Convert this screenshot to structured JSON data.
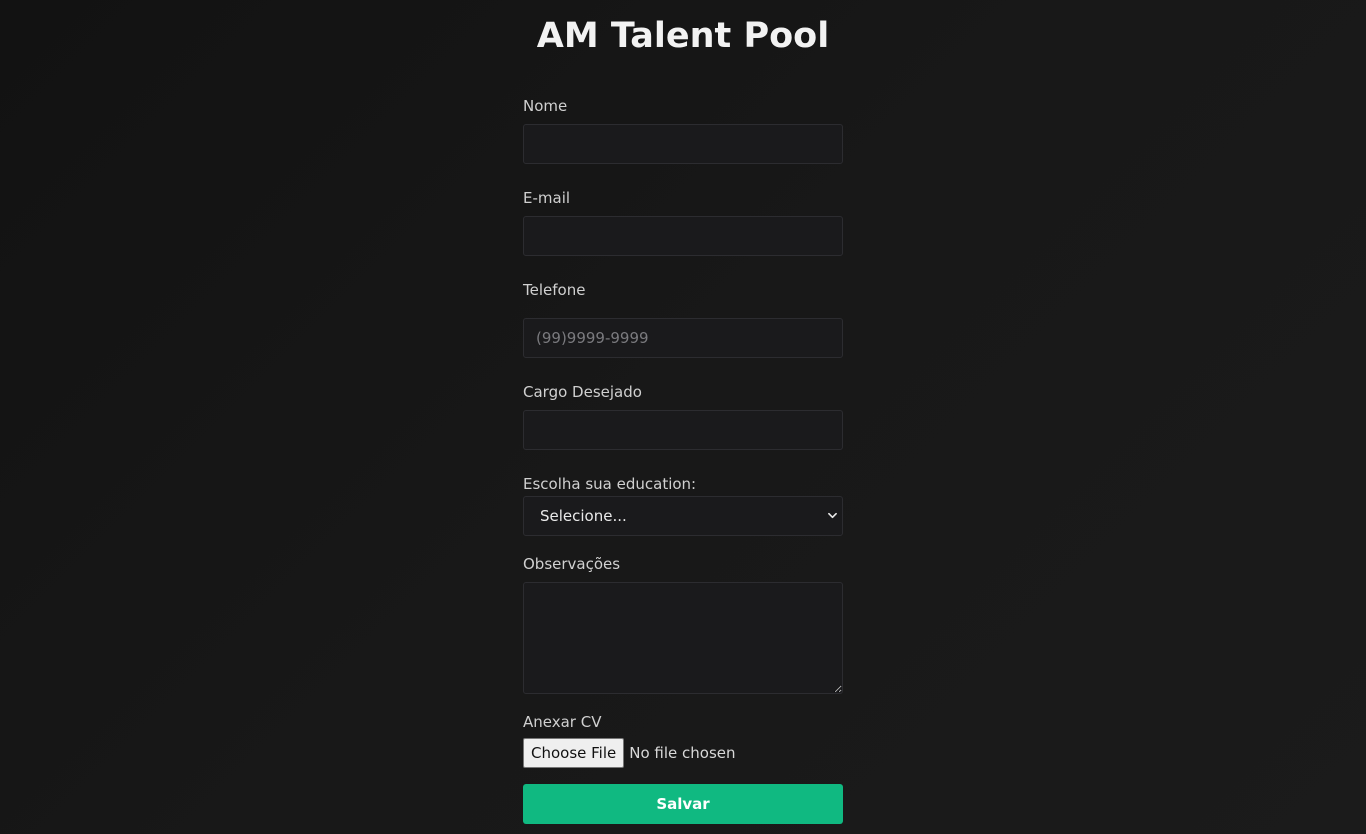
{
  "header": {
    "title": "AM Talent Pool"
  },
  "form": {
    "name": {
      "label": "Nome",
      "value": "",
      "placeholder": ""
    },
    "email": {
      "label": "E-mail",
      "value": "",
      "placeholder": ""
    },
    "phone": {
      "label": "Telefone",
      "value": "",
      "placeholder": "(99)9999-9999"
    },
    "position": {
      "label": "Cargo Desejado",
      "value": "",
      "placeholder": ""
    },
    "education": {
      "label": "Escolha sua education:",
      "selected": "Selecione..."
    },
    "notes": {
      "label": "Observações",
      "value": ""
    },
    "cv": {
      "label": "Anexar CV",
      "button_label": "Choose File",
      "status": "No file chosen"
    },
    "submit_label": "Salvar"
  },
  "colors": {
    "background": "#151515",
    "field_background": "#1a1a1c",
    "accent": "#10b981"
  },
  "icons": {
    "select_arrow": "chevron-down-icon"
  }
}
